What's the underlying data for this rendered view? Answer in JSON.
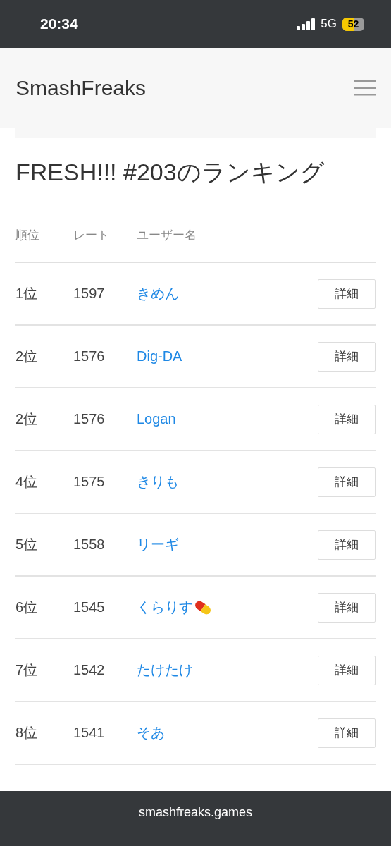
{
  "status_bar": {
    "time": "20:34",
    "network": "5G",
    "battery": "52",
    "low_power": true
  },
  "navbar": {
    "brand": "SmashFreaks"
  },
  "page": {
    "title": "FRESH!!! #203のランキング"
  },
  "table": {
    "columns": [
      "順位",
      "レート",
      "ユーザー名"
    ],
    "rows": [
      {
        "rank": "1位",
        "rate": "1597",
        "user": "きめん",
        "pill_icon": false,
        "button": "詳細"
      },
      {
        "rank": "2位",
        "rate": "1576",
        "user": "Dig-DA",
        "pill_icon": false,
        "button": "詳細"
      },
      {
        "rank": "2位",
        "rate": "1576",
        "user": "Logan",
        "pill_icon": false,
        "button": "詳細"
      },
      {
        "rank": "4位",
        "rate": "1575",
        "user": "きりも",
        "pill_icon": false,
        "button": "詳細"
      },
      {
        "rank": "5位",
        "rate": "1558",
        "user": "リーギ",
        "pill_icon": false,
        "button": "詳細"
      },
      {
        "rank": "6位",
        "rate": "1545",
        "user": "くらりす",
        "pill_icon": true,
        "button": "詳細"
      },
      {
        "rank": "7位",
        "rate": "1542",
        "user": "たけたけ",
        "pill_icon": false,
        "button": "詳細"
      },
      {
        "rank": "8位",
        "rate": "1541",
        "user": "そあ",
        "pill_icon": false,
        "button": "詳細"
      }
    ]
  },
  "url_bar": {
    "url": "smashfreaks.games"
  }
}
